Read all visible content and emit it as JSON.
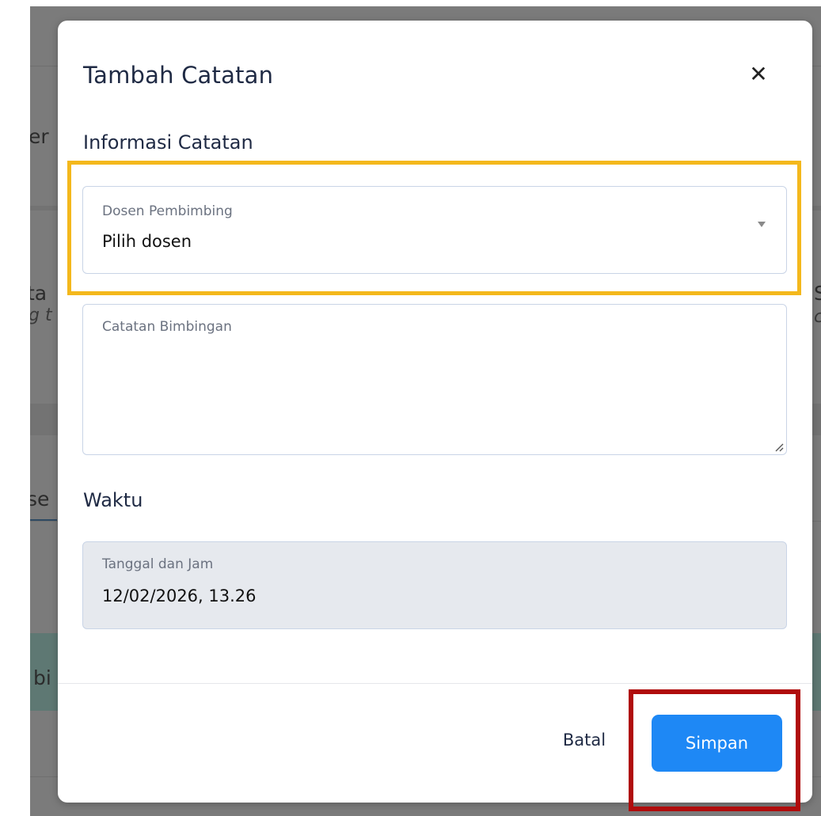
{
  "background_fragments": {
    "left_1": "er",
    "left_2": "ta",
    "left_3": "g t",
    "left_4": "se",
    "left_5": "bi",
    "right_1": "S",
    "right_2": "c"
  },
  "modal": {
    "title": "Tambah Catatan",
    "close_icon_glyph": "✕",
    "section_info_title": "Informasi Catatan",
    "lecturer_field": {
      "label": "Dosen Pembimbing",
      "value": "Pilih dosen"
    },
    "notes_field": {
      "label": "Catatan Bimbingan",
      "value": ""
    },
    "section_time_title": "Waktu",
    "datetime_field": {
      "label": "Tanggal dan Jam",
      "value": "12/02/2026, 13.26"
    },
    "footer": {
      "cancel_label": "Batal",
      "save_label": "Simpan"
    }
  },
  "colors": {
    "primary": "#1e88f5",
    "highlight_yellow": "#f4b81c",
    "highlight_red": "#b00c0c",
    "overlay": "#7b7b7b"
  }
}
